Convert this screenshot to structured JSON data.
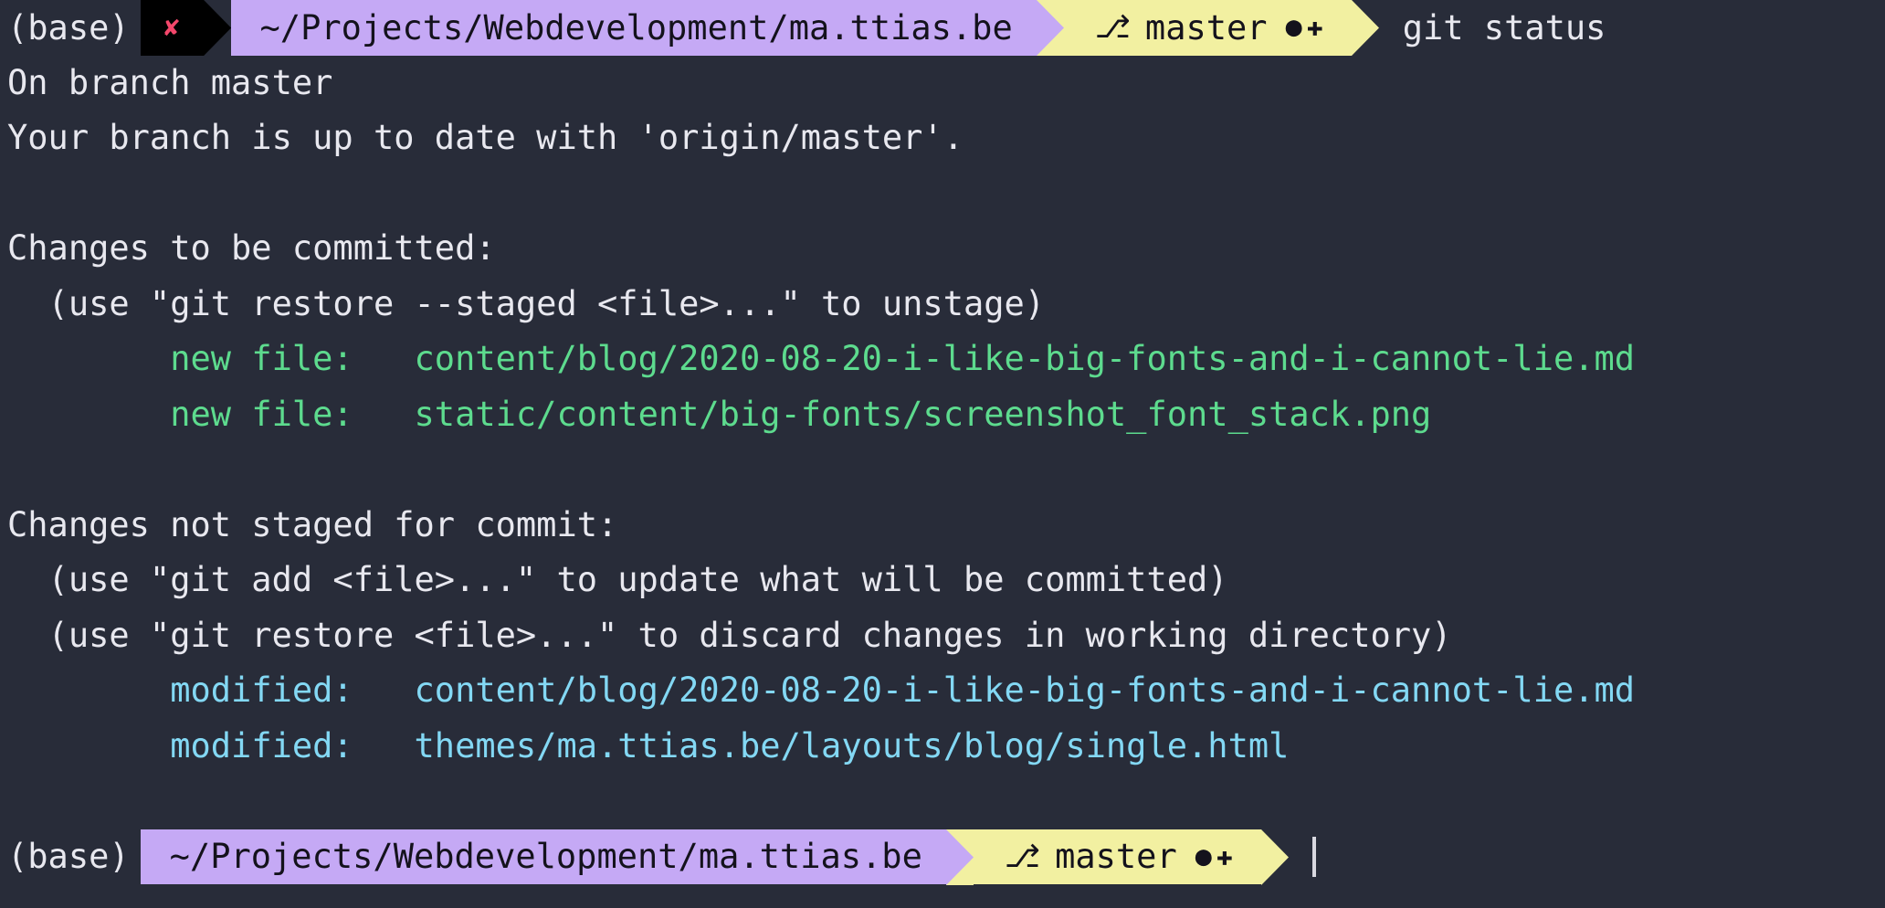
{
  "terminal": {
    "background_color": "#282c39",
    "foreground_color": "#e8e8ef",
    "command_run": "git status"
  },
  "prompt_top": {
    "conda_env": "(base)",
    "error_glyph": "✘",
    "path": "~/Projects/Webdevelopment/ma.ttias.be",
    "git_icon": "⎇",
    "git_branch": "master",
    "git_flags": "●✚",
    "command": "git status",
    "path_bg": "#c5a9f5",
    "git_bg": "#f2f0a1",
    "error_bg": "#000000",
    "error_fg": "#f4476b"
  },
  "prompt_bottom": {
    "conda_env": "(base)",
    "path": "~/Projects/Webdevelopment/ma.ttias.be",
    "git_icon": "⎇",
    "git_branch": "master",
    "git_flags": "●✚",
    "cursor": "|"
  },
  "output": {
    "branch_line": "On branch master",
    "upstream_line": "Your branch is up to date with 'origin/master'.",
    "staged_header": "Changes to be committed:",
    "staged_hint": "  (use \"git restore --staged <file>...\" to unstage)",
    "staged_files": [
      {
        "status": "new file:",
        "path": "content/blog/2020-08-20-i-like-big-fonts-and-i-cannot-lie.md",
        "color": "#5ddb8e"
      },
      {
        "status": "new file:",
        "path": "static/content/big-fonts/screenshot_font_stack.png",
        "color": "#5ddb8e"
      }
    ],
    "unstaged_header": "Changes not staged for commit:",
    "unstaged_hints": [
      "  (use \"git add <file>...\" to update what will be committed)",
      "  (use \"git restore <file>...\" to discard changes in working directory)"
    ],
    "unstaged_files": [
      {
        "status": "modified:",
        "path": "content/blog/2020-08-20-i-like-big-fonts-and-i-cannot-lie.md",
        "color": "#83d8f4"
      },
      {
        "status": "modified:",
        "path": "themes/ma.ttias.be/layouts/blog/single.html",
        "color": "#83d8f4"
      }
    ],
    "staged_entry_indent": "        ",
    "staged_status_pad": "   "
  }
}
